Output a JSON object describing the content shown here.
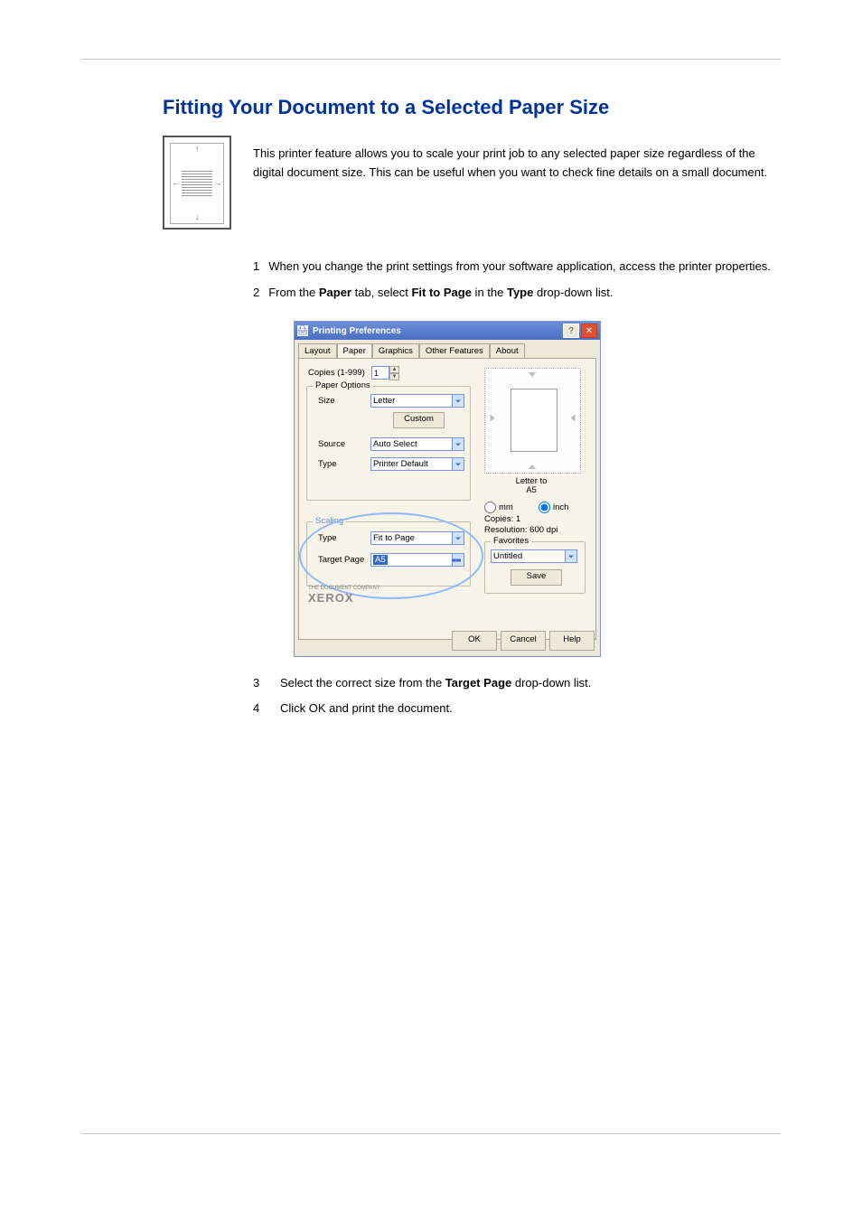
{
  "heading": "Fitting Your Document to a Selected Paper Size",
  "intro_p1": "This printer feature allows you to scale your print job to any selected paper size regardless of the digital document size. This can be useful when you want to check fine details on a small document.",
  "steps": {
    "s1_num": "1",
    "s1": "When you change the print settings from your software application, access the printer properties.",
    "s2_num": "2",
    "s2a": "From the ",
    "s2_tab": "Paper",
    "s2b": " tab, select ",
    "s2_opt": "Fit to Page",
    "s2c": " in the ",
    "s2_field": "Type",
    "s2d": " drop-down list.",
    "s3_num": "3",
    "s3a": "Select the correct size from the ",
    "s3_field": "Target Page",
    "s3b": " drop-down list.",
    "s4_num": "4",
    "s4": "Click OK and print the document."
  },
  "dialog": {
    "title": "Printing Preferences",
    "tabs": {
      "layout": "Layout",
      "paper": "Paper",
      "graphics": "Graphics",
      "other": "Other Features",
      "about": "About"
    },
    "copies_label": "Copies (1-999)",
    "copies_value": "1",
    "paper_options_legend": "Paper Options",
    "size_label": "Size",
    "size_value": "Letter",
    "custom_btn": "Custom",
    "source_label": "Source",
    "source_value": "Auto Select",
    "type_label": "Type",
    "type_value": "Printer Default",
    "scaling_legend": "Scaling",
    "scaling_type_label": "Type",
    "scaling_type_value": "Fit to Page",
    "target_label": "Target Page",
    "target_value": "A5",
    "preview_label_line1": "Letter to",
    "preview_label_line2": "A5",
    "unit_mm": "mm",
    "unit_inch": "inch",
    "status_copies": "Copies: 1",
    "status_resolution": "Resolution: 600 dpi",
    "favorites_legend": "Favorites",
    "favorites_value": "Untitled",
    "save_btn": "Save",
    "ok_btn": "OK",
    "cancel_btn": "Cancel",
    "help_btn": "Help",
    "company_line": "THE DOCUMENT COMPANY",
    "brand": "XEROX"
  }
}
